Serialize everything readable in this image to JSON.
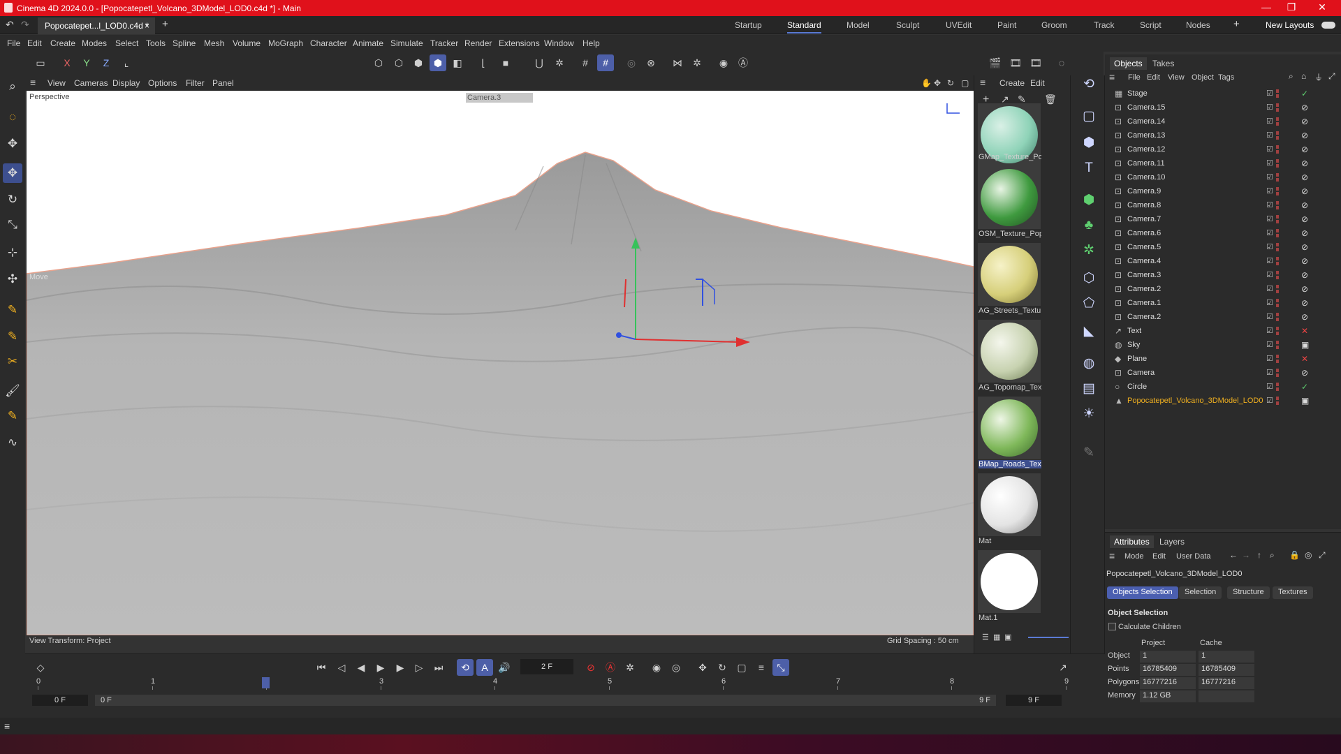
{
  "window": {
    "title": "Cinema 4D 2024.0.0 - [Popocatepetl_Volcano_3DModel_LOD0.c4d *] - Main",
    "minimize": "—",
    "maximize": "❐",
    "close": "✕"
  },
  "tabs": {
    "doc_tab": "Popocatepet...l_LOD0.c4d *",
    "doc_close": "×",
    "add": "+",
    "layouts": [
      "Startup",
      "Standard",
      "Model",
      "Sculpt",
      "UVEdit",
      "Paint",
      "Groom",
      "Track",
      "Script",
      "Nodes"
    ],
    "active_layout": "Standard",
    "new_layouts": "New Layouts"
  },
  "menu": [
    "File",
    "Edit",
    "Create",
    "Modes",
    "Select",
    "Tools",
    "Spline",
    "Mesh",
    "Volume",
    "MoGraph",
    "Character",
    "Animate",
    "Simulate",
    "Tracker",
    "Render",
    "Extensions",
    "Window",
    "Help"
  ],
  "axis_toggles": [
    "X",
    "Y",
    "Z"
  ],
  "viewport": {
    "menu": [
      "View",
      "Cameras",
      "Display",
      "Options",
      "Filter",
      "Panel"
    ],
    "projection": "Perspective",
    "camera": "Camera.3",
    "view_transform": "View Transform: Project",
    "grid_spacing": "Grid Spacing : 50 cm",
    "tool_hint": "Move"
  },
  "materials": {
    "menu": [
      "Create",
      "Edit"
    ],
    "items": [
      {
        "name": "GMap_Texture_Po",
        "color": "#8fd3b8"
      },
      {
        "name": "OSM_Texture_Pop",
        "color": "#3f9a3f"
      },
      {
        "name": "AG_Streets_Textur",
        "color": "#d6cf7a"
      },
      {
        "name": "AG_Topomap_Tex",
        "color": "#c7d2b0"
      },
      {
        "name": "BMap_Roads_Text",
        "color": "#7fb85a"
      },
      {
        "name": "Mat",
        "color": "#e4e4e4"
      },
      {
        "name": "Mat.1",
        "color": "#ffffff"
      }
    ],
    "selected": "BMap_Roads_Text"
  },
  "objects": {
    "tabs": [
      "Objects",
      "Takes"
    ],
    "menu": [
      "File",
      "Edit",
      "View",
      "Object",
      "Tags"
    ],
    "items": [
      "Stage",
      "Camera.15",
      "Camera.14",
      "Camera.13",
      "Camera.12",
      "Camera.11",
      "Camera.10",
      "Camera.9",
      "Camera.8",
      "Camera.7",
      "Camera.6",
      "Camera.5",
      "Camera.4",
      "Camera.3",
      "Camera.2",
      "Camera.1",
      "Camera.2",
      "Text",
      "Sky",
      "Plane",
      "Camera",
      "Circle",
      "Popocatepetl_Volcano_3DModel_LOD0"
    ],
    "selected": "Popocatepetl_Volcano_3DModel_LOD0"
  },
  "attributes": {
    "tabs": [
      "Attributes",
      "Layers"
    ],
    "menu": [
      "Mode",
      "Edit",
      "User Data"
    ],
    "object_name": "Popocatepetl_Volcano_3DModel_LOD0",
    "sub_tabs": [
      "Objects Selection",
      "Selection",
      "Structure",
      "Textures"
    ],
    "section": "Object Selection",
    "checkbox": "Calculate Children",
    "col_project": "Project",
    "col_cache": "Cache",
    "rows": [
      {
        "label": "Object",
        "project": "1",
        "cache": "1"
      },
      {
        "label": "Points",
        "project": "16785409",
        "cache": "16785409"
      },
      {
        "label": "Polygons",
        "project": "16777216",
        "cache": "16777216"
      },
      {
        "label": "Memory",
        "project": "1.12 GB",
        "cache": ""
      }
    ]
  },
  "timeline": {
    "current_frame": "2 F",
    "ticks": [
      "0",
      "1",
      "2",
      "3",
      "4",
      "5",
      "6",
      "7",
      "8",
      "9"
    ],
    "start": "0 F",
    "range_start": "0 F",
    "range_end": "9 F",
    "end": "9 F",
    "playhead_frame": 2
  },
  "colors": {
    "accent": "#4d5fa8",
    "title_bar": "#e0111b",
    "selected_object": "#f0b020"
  }
}
